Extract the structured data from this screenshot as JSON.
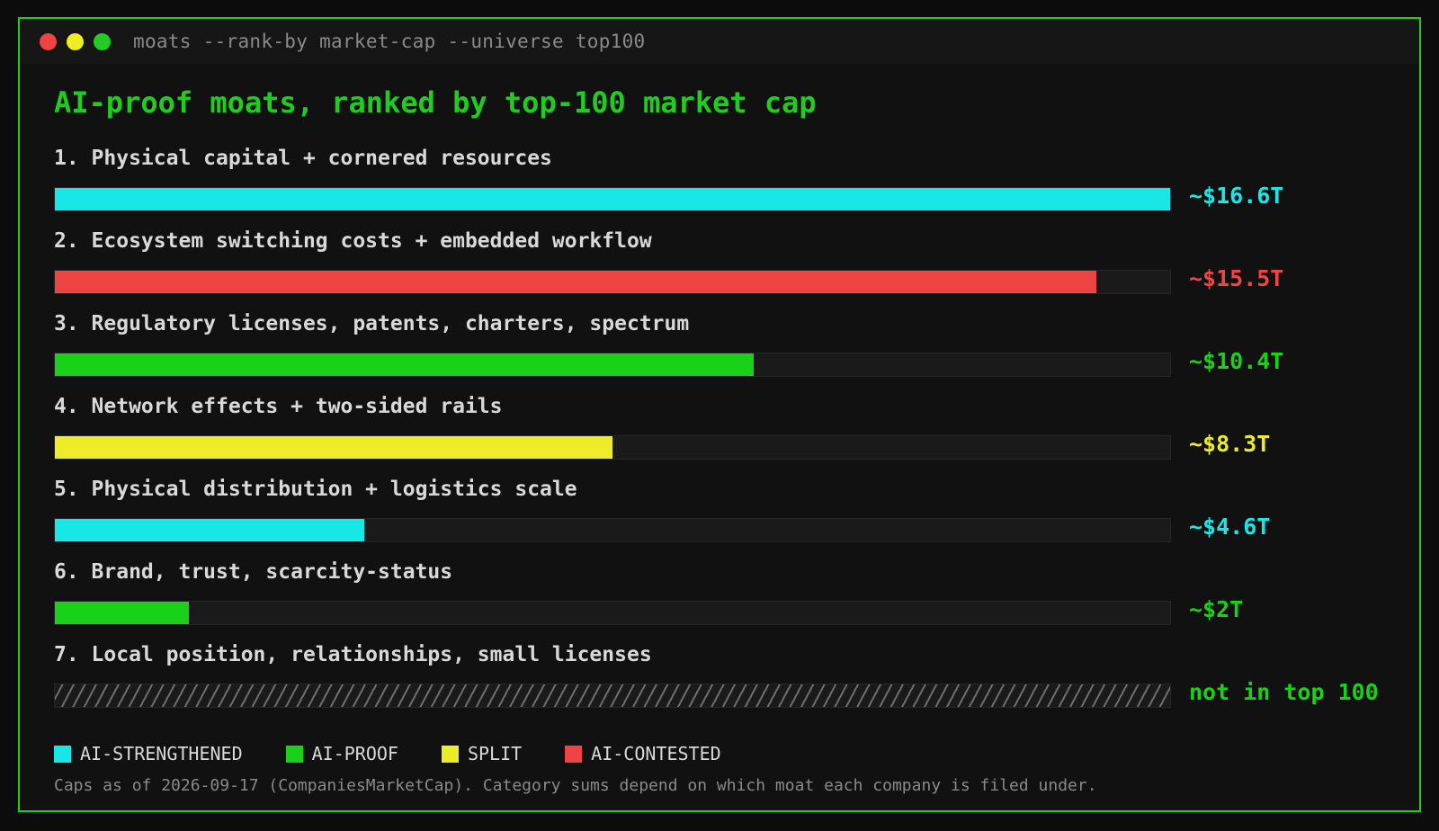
{
  "window": {
    "command": "moats --rank-by market-cap --universe top100"
  },
  "colors": {
    "frame": "#1fcc1f",
    "ai_strengthened": "#19e6e6",
    "ai_proof": "#18d118",
    "split": "#ecec28",
    "ai_contested": "#ee4444"
  },
  "chart_data": {
    "type": "bar",
    "orientation": "horizontal",
    "title": "AI-proof moats, ranked by top-100 market cap",
    "unit": "$T",
    "xlim": [
      0,
      16.6
    ],
    "categories": [
      "1. Physical capital + cornered resources",
      "2. Ecosystem switching costs + embedded workflow",
      "3. Regulatory licenses, patents, charters, spectrum",
      "4. Network effects + two-sided rails",
      "5. Physical distribution + logistics scale",
      "6. Brand, trust, scarcity-status",
      "7. Local position, relationships, small licenses"
    ],
    "values": [
      16.6,
      15.5,
      10.4,
      8.3,
      4.6,
      2,
      null
    ],
    "value_labels": [
      "~$16.6T",
      "~$15.5T",
      "~$10.4T",
      "~$8.3T",
      "~$4.6T",
      "~$2T",
      "not in top 100"
    ],
    "groups": [
      "ai_strengthened",
      "ai_contested",
      "ai_proof",
      "split",
      "ai_strengthened",
      "ai_proof",
      "ai_proof"
    ],
    "legend": [
      {
        "key": "ai_strengthened",
        "label": "AI-STRENGTHENED"
      },
      {
        "key": "ai_proof",
        "label": "AI-PROOF"
      },
      {
        "key": "split",
        "label": "SPLIT"
      },
      {
        "key": "ai_contested",
        "label": "AI-CONTESTED"
      }
    ],
    "legend_placement": "bottom-left",
    "footnote": "Caps as of 2026-09-17 (CompaniesMarketCap). Category sums depend on which moat each company is filed under."
  }
}
